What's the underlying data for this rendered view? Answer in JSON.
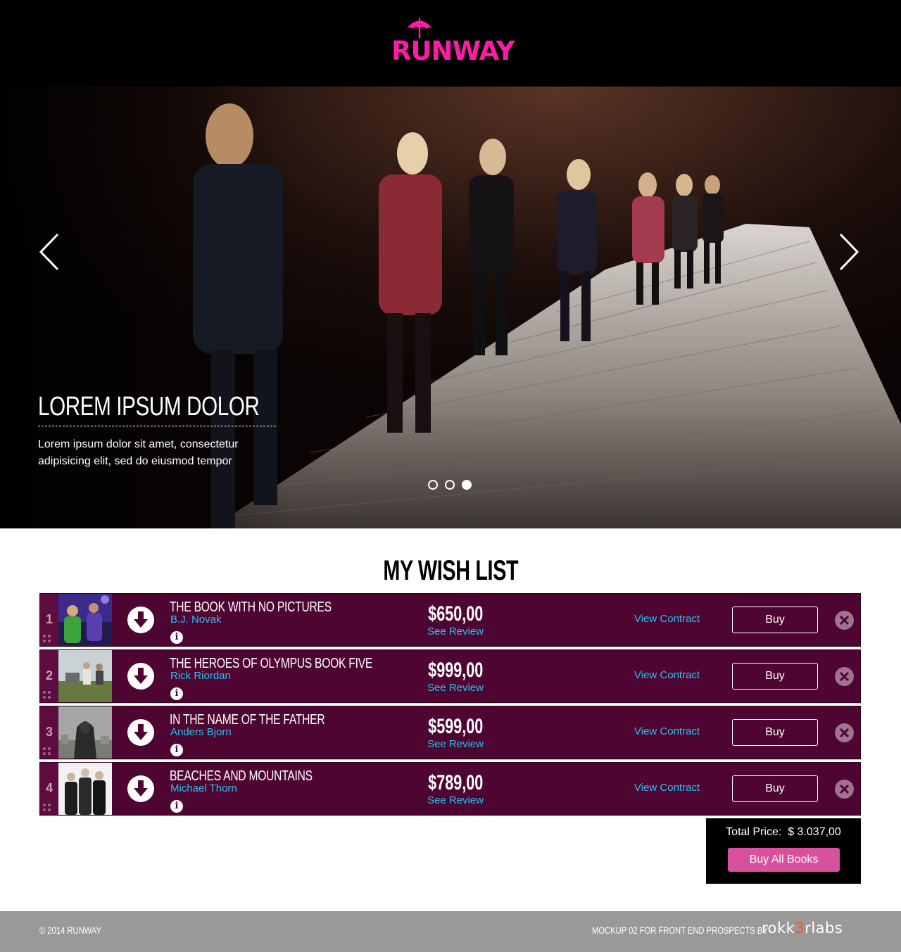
{
  "logo": {
    "text": "RUNWAY",
    "color": "#ff1aa8"
  },
  "hero": {
    "title": "LOREM IPSUM DOLOR",
    "text": "Lorem ipsum dolor sit amet, consectetur adipisicing elit, sed do eiusmod tempor",
    "prev_icon": "chevron-left-icon",
    "next_icon": "chevron-right-icon",
    "slides": 3,
    "active_slide": 3
  },
  "wishlist": {
    "title": "MY WISH LIST",
    "items": [
      {
        "num": "1",
        "title": "THE BOOK WITH NO PICTURES",
        "author": "B.J. Novak",
        "price": "$650,00",
        "review": "See Review",
        "contract": "View Contract",
        "buy": "Buy"
      },
      {
        "num": "2",
        "title": "THE HEROES OF OLYMPUS BOOK FIVE",
        "author": "Rick Riordan",
        "price": "$999,00",
        "review": "See Review",
        "contract": "View Contract",
        "buy": "Buy"
      },
      {
        "num": "3",
        "title": "IN THE NAME OF THE FATHER",
        "author": "Anders Bjorn",
        "price": "$599,00",
        "review": "See Review",
        "contract": "View Contract",
        "buy": "Buy"
      },
      {
        "num": "4",
        "title": "BEACHES AND MOUNTAINS",
        "author": "Michael Thorn",
        "price": "$789,00",
        "review": "See Review",
        "contract": "View Contract",
        "buy": "Buy"
      }
    ],
    "row_color": "#4f0532",
    "link_color": "#26c3f0",
    "total_label": "Total Price:",
    "total_value": "$ 3.037,00",
    "buy_all": "Buy All Books",
    "buy_all_color": "#d9519e"
  },
  "footer": {
    "copyright": "© 2014 RUNWAY",
    "credit": "MOCKUP 02 FOR FRONT END PROSPECTS BY",
    "brand_pre": "rokk",
    "brand_mid": "3",
    "brand_post": "rlabs"
  }
}
